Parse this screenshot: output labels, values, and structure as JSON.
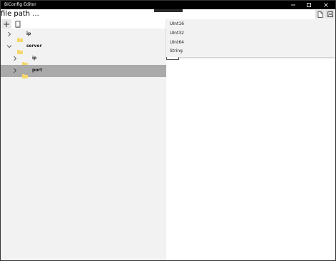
{
  "window": {
    "title": "BiConfig Editor"
  },
  "file_path": {
    "label": "file path ..."
  },
  "toolbar": {
    "add_icon": "plus-icon",
    "document_icon": "document-icon",
    "new_file_icon": "new-file-icon",
    "save_icon": "save-icon"
  },
  "tree": {
    "items": [
      {
        "label": "ip",
        "level": 0,
        "expanded": false
      },
      {
        "label": "server",
        "level": 0,
        "expanded": true
      },
      {
        "label": "ip",
        "level": 1,
        "expanded": false
      },
      {
        "label": "port",
        "level": 1,
        "expanded": false,
        "selected": true
      }
    ]
  },
  "type_dropdown": {
    "options": [
      "UInt16",
      "UInt32",
      "UInt64",
      "String"
    ]
  },
  "colors": {
    "titlebar": "#000000",
    "tree_background": "#f2f2f2",
    "selected_row": "#aaaaaa",
    "folder": "#f5d76e",
    "dropdown_background": "#f2f2f2"
  }
}
